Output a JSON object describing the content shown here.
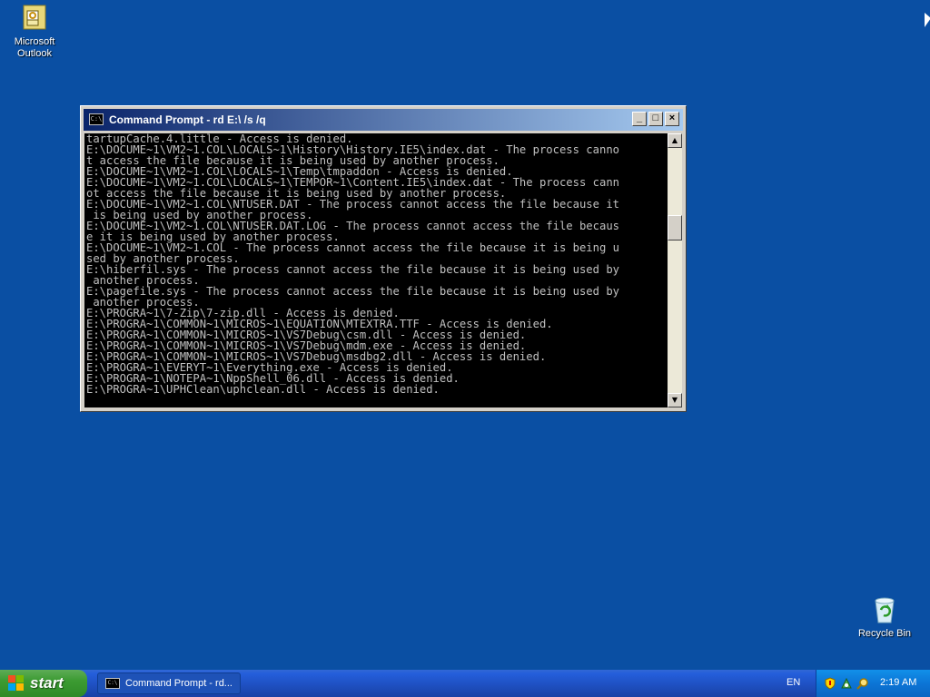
{
  "desktop": {
    "icons": [
      {
        "label": "Microsoft Outlook"
      },
      {
        "label": "Recycle Bin"
      }
    ]
  },
  "window": {
    "title": "Command Prompt - rd E:\\ /s /q",
    "icon_text": "C:\\",
    "buttons": {
      "minimize": "_",
      "maximize": "□",
      "close": "×"
    }
  },
  "console": {
    "lines": [
      "tartupCache.4.little - Access is denied.",
      "E:\\DOCUME~1\\VM2~1.COL\\LOCALS~1\\History\\History.IE5\\index.dat - The process canno",
      "t access the file because it is being used by another process.",
      "E:\\DOCUME~1\\VM2~1.COL\\LOCALS~1\\Temp\\tmpaddon - Access is denied.",
      "E:\\DOCUME~1\\VM2~1.COL\\LOCALS~1\\TEMPOR~1\\Content.IE5\\index.dat - The process cann",
      "ot access the file because it is being used by another process.",
      "E:\\DOCUME~1\\VM2~1.COL\\NTUSER.DAT - The process cannot access the file because it",
      " is being used by another process.",
      "E:\\DOCUME~1\\VM2~1.COL\\NTUSER.DAT.LOG - The process cannot access the file becaus",
      "e it is being used by another process.",
      "E:\\DOCUME~1\\VM2~1.COL - The process cannot access the file because it is being u",
      "sed by another process.",
      "E:\\hiberfil.sys - The process cannot access the file because it is being used by",
      " another process.",
      "E:\\pagefile.sys - The process cannot access the file because it is being used by",
      " another process.",
      "E:\\PROGRA~1\\7-Zip\\7-zip.dll - Access is denied.",
      "E:\\PROGRA~1\\COMMON~1\\MICROS~1\\EQUATION\\MTEXTRA.TTF - Access is denied.",
      "E:\\PROGRA~1\\COMMON~1\\MICROS~1\\VS7Debug\\csm.dll - Access is denied.",
      "E:\\PROGRA~1\\COMMON~1\\MICROS~1\\VS7Debug\\mdm.exe - Access is denied.",
      "E:\\PROGRA~1\\COMMON~1\\MICROS~1\\VS7Debug\\msdbg2.dll - Access is denied.",
      "E:\\PROGRA~1\\EVERYT~1\\Everything.exe - Access is denied.",
      "E:\\PROGRA~1\\NOTEPA~1\\NppShell_06.dll - Access is denied.",
      "E:\\PROGRA~1\\UPHClean\\uphclean.dll - Access is denied."
    ]
  },
  "taskbar": {
    "start_label": "start",
    "tasks": [
      {
        "label": "Command Prompt - rd..."
      }
    ],
    "language": "EN",
    "clock": "2:19 AM"
  },
  "colors": {
    "desktop_bg": "#0a4fa3",
    "console_bg": "#000000",
    "console_fg": "#c0c0c0"
  }
}
